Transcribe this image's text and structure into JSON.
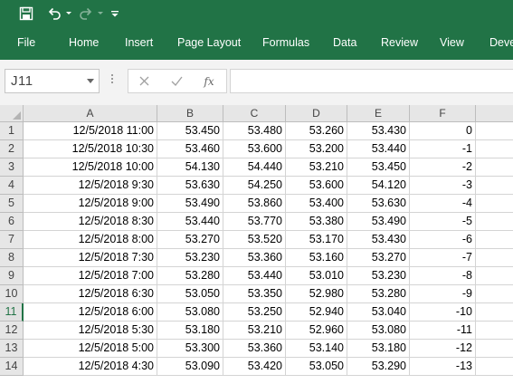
{
  "ribbon": {
    "tabs": [
      "File",
      "Home",
      "Insert",
      "Page Layout",
      "Formulas",
      "Data",
      "Review",
      "View",
      "Deve"
    ]
  },
  "quick_access": {
    "icons": [
      "save-icon",
      "undo-icon",
      "redo-icon",
      "customize-icon"
    ]
  },
  "formula_bar": {
    "name_box": "J11",
    "fx_label": "fx",
    "formula": ""
  },
  "columns": [
    "A",
    "B",
    "C",
    "D",
    "E",
    "F"
  ],
  "selected_row": "11",
  "rows": [
    {
      "num": "1",
      "cells": [
        "12/5/2018 11:00",
        "53.450",
        "53.480",
        "53.260",
        "53.430",
        "0"
      ]
    },
    {
      "num": "2",
      "cells": [
        "12/5/2018 10:30",
        "53.460",
        "53.600",
        "53.200",
        "53.440",
        "-1"
      ]
    },
    {
      "num": "3",
      "cells": [
        "12/5/2018 10:00",
        "54.130",
        "54.440",
        "53.210",
        "53.450",
        "-2"
      ]
    },
    {
      "num": "4",
      "cells": [
        "12/5/2018 9:30",
        "53.630",
        "54.250",
        "53.600",
        "54.120",
        "-3"
      ]
    },
    {
      "num": "5",
      "cells": [
        "12/5/2018 9:00",
        "53.490",
        "53.860",
        "53.400",
        "53.630",
        "-4"
      ]
    },
    {
      "num": "6",
      "cells": [
        "12/5/2018 8:30",
        "53.440",
        "53.770",
        "53.380",
        "53.490",
        "-5"
      ]
    },
    {
      "num": "7",
      "cells": [
        "12/5/2018 8:00",
        "53.270",
        "53.520",
        "53.170",
        "53.430",
        "-6"
      ]
    },
    {
      "num": "8",
      "cells": [
        "12/5/2018 7:30",
        "53.230",
        "53.360",
        "53.160",
        "53.270",
        "-7"
      ]
    },
    {
      "num": "9",
      "cells": [
        "12/5/2018 7:00",
        "53.280",
        "53.440",
        "53.010",
        "53.230",
        "-8"
      ]
    },
    {
      "num": "10",
      "cells": [
        "12/5/2018 6:30",
        "53.050",
        "53.350",
        "52.980",
        "53.280",
        "-9"
      ]
    },
    {
      "num": "11",
      "cells": [
        "12/5/2018 6:00",
        "53.080",
        "53.250",
        "52.940",
        "53.040",
        "-10"
      ]
    },
    {
      "num": "12",
      "cells": [
        "12/5/2018 5:30",
        "53.180",
        "53.210",
        "52.960",
        "53.080",
        "-11"
      ]
    },
    {
      "num": "13",
      "cells": [
        "12/5/2018 5:00",
        "53.300",
        "53.360",
        "53.140",
        "53.180",
        "-12"
      ]
    },
    {
      "num": "14",
      "cells": [
        "12/5/2018 4:30",
        "53.090",
        "53.420",
        "53.050",
        "53.290",
        "-13"
      ]
    }
  ],
  "colors": {
    "excel_green": "#217346",
    "header_gray": "#e6e6e6",
    "gridline": "#d4d4d4"
  }
}
